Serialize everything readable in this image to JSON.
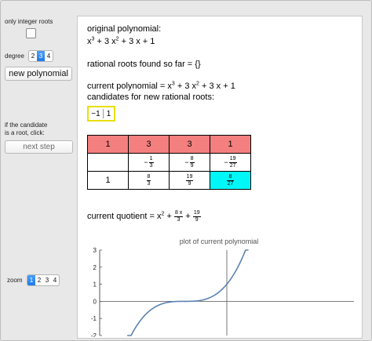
{
  "sidebar": {
    "integer_roots_label": "only integer roots",
    "degree_label": "degree",
    "degree_options": [
      "2",
      "3",
      "4"
    ],
    "degree_selected": "3",
    "new_polynomial_label": "new polynomial",
    "candidate_hint_line1": "if the candidate",
    "candidate_hint_line2": "is a root, click:",
    "next_step_label": "next step",
    "zoom_label": "zoom",
    "zoom_options": [
      "1",
      "2",
      "3",
      "4"
    ],
    "zoom_selected": "1"
  },
  "main": {
    "original_label": "original polynomial:",
    "original_poly": {
      "t1": "x",
      "e1": "3",
      "t2": " + 3 x",
      "e2": "2",
      "t3": " + 3 x + 1"
    },
    "rational_roots_text": "rational roots found so far = {}",
    "current_poly_prefix": "current polynomial = ",
    "current_poly": {
      "t1": "x",
      "e1": "3",
      "t2": " + 3 x",
      "e2": "2",
      "t3": " + 3 x + 1"
    },
    "candidates_label": "candidates for new rational roots:",
    "candidates": [
      "−1",
      "1"
    ],
    "table": {
      "row1": [
        "1",
        "3",
        "3",
        "1"
      ],
      "row2": [
        {
          "sign": "",
          "num": "",
          "den": ""
        },
        {
          "sign": "−",
          "num": "1",
          "den": "3"
        },
        {
          "sign": "−",
          "num": "8",
          "den": "9"
        },
        {
          "sign": "−",
          "num": "19",
          "den": "27"
        }
      ],
      "row3": [
        {
          "whole": "1"
        },
        {
          "num": "8",
          "den": "3"
        },
        {
          "num": "19",
          "den": "9"
        },
        {
          "num": "8",
          "den": "27"
        }
      ]
    },
    "quotient_prefix": "current quotient = ",
    "quotient": {
      "x": "x",
      "e": "2",
      "plus1": " + ",
      "f1num": "8 x",
      "f1den": "3",
      "plus2": " + ",
      "f2num": "19",
      "f2den": "9"
    },
    "colors": {
      "header": "#f47f7f",
      "highlight": "#00f7f7",
      "candidate_border": "#e8e000",
      "curve": "#5b82b5"
    }
  },
  "chart_data": {
    "type": "line",
    "title": "plot of current polynomial",
    "function": "x^3 + 3x^2 + 3x + 1",
    "xlabel": "",
    "ylabel": "",
    "ylim": [
      -2,
      3
    ],
    "xlim": [
      -3,
      3
    ],
    "yticks": [
      "3",
      "2",
      "1",
      "0",
      "-1",
      "-2"
    ],
    "grid": false
  }
}
